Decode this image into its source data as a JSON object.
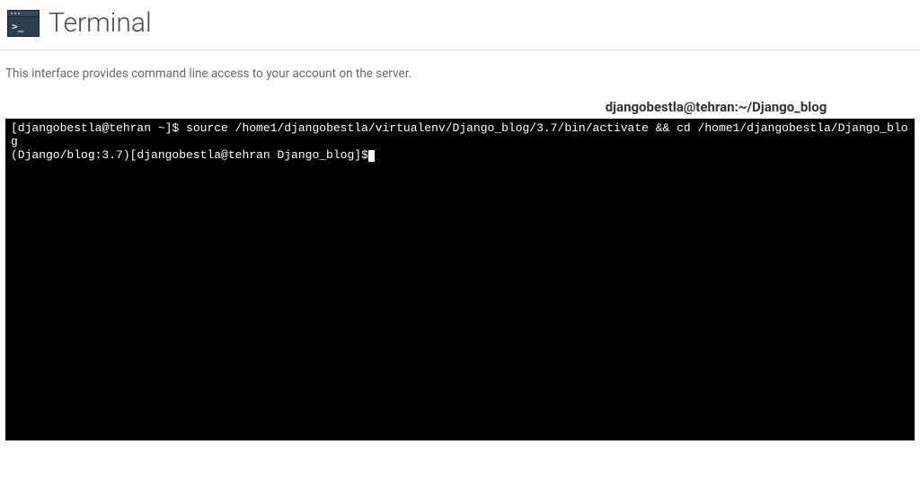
{
  "header": {
    "title": "Terminal",
    "icon_prompt": ">_"
  },
  "description": "This interface provides command line access to your account on the server.",
  "terminal": {
    "window_title": "djangobestla@tehran:~/Django_blog",
    "lines": {
      "line1_prompt": "[djangobestla@tehran ~]$ ",
      "line1_command": "source /home1/djangobestla/virtualenv/Django_blog/3.7/bin/activate && cd /home1/djangobestla/Django_blog",
      "line2_prompt": "(Django/blog:3.7)[djangobestla@tehran Django_blog]$"
    }
  }
}
